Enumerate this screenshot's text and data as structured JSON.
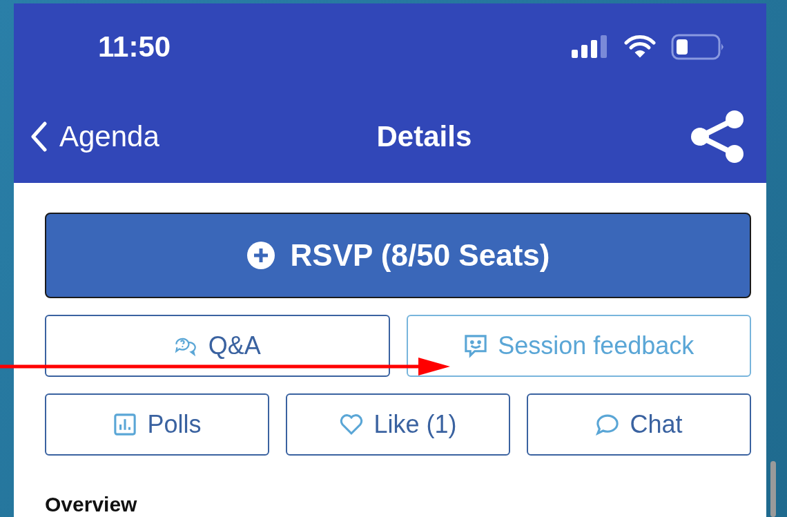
{
  "status_bar": {
    "time": "11:50"
  },
  "nav": {
    "back": "Agenda",
    "title": "Details"
  },
  "rsvp": {
    "label": "RSVP (8/50 Seats)"
  },
  "actions": [
    {
      "kind": "qa",
      "label": "Q&A",
      "highlighted": false
    },
    {
      "kind": "feedback",
      "label": "Session feedback",
      "highlighted": true
    }
  ],
  "actions2": [
    {
      "kind": "polls",
      "label": "Polls",
      "highlighted": false
    },
    {
      "kind": "like",
      "label": "Like (1)",
      "highlighted": false
    },
    {
      "kind": "chat",
      "label": "Chat",
      "highlighted": false
    }
  ],
  "section": {
    "heading": "Overview"
  }
}
